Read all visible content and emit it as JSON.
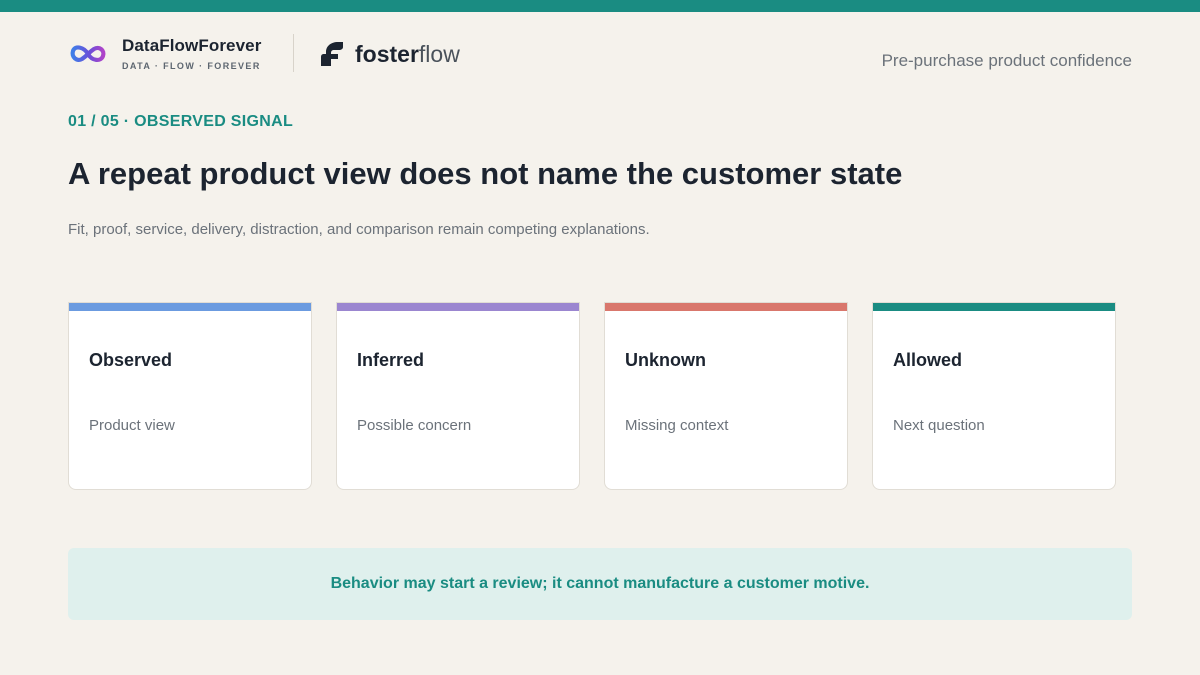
{
  "brand": {
    "primary_name": "DataFlowForever",
    "primary_tagline": "DATA · FLOW · FOREVER",
    "secondary_name_bold": "foster",
    "secondary_name_light": "flow"
  },
  "header": {
    "context_label": "Pre-purchase product confidence"
  },
  "slide": {
    "kicker": "01 / 05 · OBSERVED SIGNAL",
    "title": "A repeat product view does not name the customer state",
    "subtitle": "Fit, proof, service, delivery, distraction, and comparison remain competing explanations."
  },
  "cards": [
    {
      "title": "Observed",
      "text": "Product view",
      "accent": "#6b9be0"
    },
    {
      "title": "Inferred",
      "text": "Possible concern",
      "accent": "#9b86d0"
    },
    {
      "title": "Unknown",
      "text": "Missing context",
      "accent": "#d9776c"
    },
    {
      "title": "Allowed",
      "text": "Next question",
      "accent": "#1a8c82"
    }
  ],
  "footer": {
    "note": "Behavior may start a review; it cannot manufacture a customer motive."
  },
  "colors": {
    "brand_teal": "#1a8c82",
    "background": "#f5f2ec",
    "note_background": "#dff0ed"
  },
  "icons": {
    "primary_logo": "infinity-loop-icon",
    "secondary_logo": "leaf-f-icon"
  }
}
